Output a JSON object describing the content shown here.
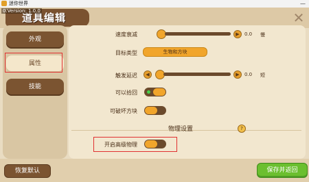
{
  "window": {
    "title": "迷你世界",
    "minimize": "—"
  },
  "header": {
    "title": "道具编辑",
    "version": "0.Version: 1.0.0"
  },
  "sidebar": {
    "tabs": [
      {
        "label": "外观"
      },
      {
        "label": "属性"
      },
      {
        "label": "技能"
      }
    ],
    "active_tab": "属性"
  },
  "settings": {
    "speed_decay": {
      "label": "速度衰减",
      "value": "0.0",
      "unit": "慢"
    },
    "target_type": {
      "label": "目标类型",
      "value": "生物和方块"
    },
    "trigger_delay": {
      "label": "触发延迟",
      "value": "0.0",
      "unit": "短"
    },
    "can_pickup": {
      "label": "可以拾回",
      "state": true
    },
    "can_break_block": {
      "label": "可破坏方块",
      "state": false
    },
    "physics": {
      "section_title": "物理设置",
      "advanced_label": "开启高级物理",
      "advanced_state": false
    }
  },
  "help": {
    "symbol": "?"
  },
  "close": {
    "symbol": "✕"
  },
  "footer": {
    "reset_label": "恢复默认",
    "save_label": "保存并返回"
  },
  "colors": {
    "brown": "#7b5431",
    "orange": "#f1a52b",
    "green": "#6bbf2f",
    "highlight": "#e03030"
  }
}
